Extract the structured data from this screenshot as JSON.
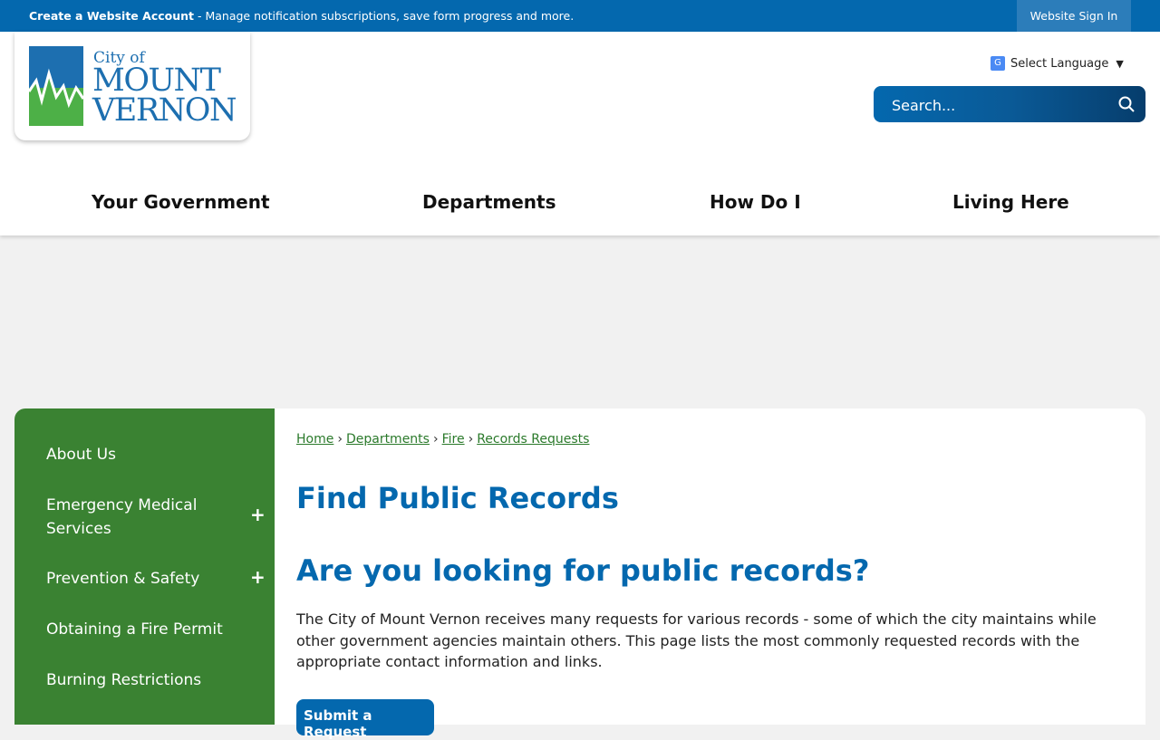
{
  "topbar": {
    "account_link": "Create a Website Account",
    "account_desc": " - Manage notification subscriptions, save form progress and more.",
    "signin": "Website Sign In"
  },
  "logo": {
    "city_of": "City of",
    "line1": "MOUNT",
    "line2": "VERNON"
  },
  "language": {
    "label": "Select Language"
  },
  "search": {
    "placeholder": "Search..."
  },
  "nav": {
    "items": [
      "Your Government",
      "Departments",
      "How Do I",
      "Living Here"
    ]
  },
  "sidebar": {
    "items": [
      {
        "label": "About Us",
        "expandable": false
      },
      {
        "label": "Emergency Medical Services",
        "expandable": true
      },
      {
        "label": "Prevention & Safety",
        "expandable": true
      },
      {
        "label": "Obtaining a Fire Permit",
        "expandable": false
      },
      {
        "label": "Burning Restrictions",
        "expandable": false
      }
    ],
    "expand_symbol": "+"
  },
  "breadcrumb": {
    "items": [
      "Home",
      "Departments",
      "Fire",
      "Records Requests"
    ],
    "separator": "›"
  },
  "main": {
    "title": "Find Public Records",
    "subtitle": "Are you looking for public records?",
    "paragraph": "The City of Mount Vernon receives many requests for various records - some of which the city maintains while other government agencies maintain others. This page lists the most commonly requested records with the appropriate contact information and links.",
    "button": "Submit a Request"
  },
  "colors": {
    "brand_blue": "#0468ae",
    "sidebar_green": "#3a8232",
    "link_green": "#2b7a2b"
  }
}
